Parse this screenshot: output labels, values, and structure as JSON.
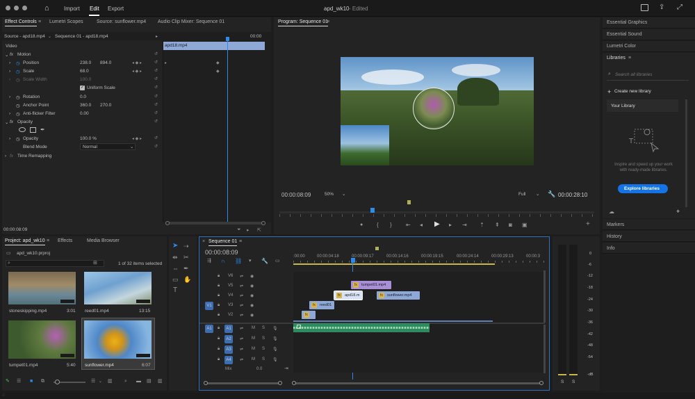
{
  "titlebar": {
    "menu_import": "Import",
    "menu_edit": "Edit",
    "menu_export": "Export",
    "doc_title": "apd_wk10",
    "doc_status": "- Edited"
  },
  "source_tabs": [
    "Effect Controls",
    "Lumetri Scopes",
    "Source: sunflower.mp4",
    "Audio Clip Mixer: Sequence 01"
  ],
  "effect_controls": {
    "source_label": "Source - apd18.mp4",
    "sequence_label": "Sequence 01 - apd18.mp4",
    "timeline_start": "00:00",
    "clip_name": "apd18.mp4",
    "section_video": "Video",
    "motion": "Motion",
    "position": "Position",
    "position_x": "238.0",
    "position_y": "894.0",
    "scale": "Scale",
    "scale_val": "68.0",
    "scale_width": "Scale Width",
    "scale_width_val": "100.0",
    "uniform_scale": "Uniform Scale",
    "rotation": "Rotation",
    "rotation_val": "0.0",
    "anchor": "Anchor Point",
    "anchor_x": "360.0",
    "anchor_y": "270.0",
    "antiflicker": "Anti-flicker Filter",
    "antiflicker_val": "0.00",
    "opacity_section": "Opacity",
    "opacity": "Opacity",
    "opacity_val": "100.0 %",
    "blend_mode": "Blend Mode",
    "blend_val": "Normal",
    "time_remap": "Time Remapping",
    "timecode": "00:00:08:09"
  },
  "program": {
    "title": "Program: Sequence 01",
    "timecode": "00:00:08:09",
    "zoom": "50%",
    "quality": "Full",
    "duration": "00:00:28:10"
  },
  "right_panel": {
    "essential_graphics": "Essential Graphics",
    "essential_sound": "Essential Sound",
    "lumetri_color": "Lumetri Color",
    "libraries": "Libraries",
    "search_placeholder": "Search all libraries",
    "create_library": "Create new library",
    "your_library": "Your Library",
    "inspire_text": "Inspire and speed up your work with ready-made libraries.",
    "explore_button": "Explore libraries",
    "markers": "Markers",
    "history": "History",
    "info": "Info"
  },
  "project": {
    "tab_project": "Project: apd_wk10",
    "tab_effects": "Effects",
    "tab_media": "Media Browser",
    "file_name": "apd_wk10.prproj",
    "items_selected": "1 of 32 items selected",
    "thumbs": [
      {
        "name": "stoneskipping.mp4",
        "dur": "3:01"
      },
      {
        "name": "reed01.mp4",
        "dur": "13:15"
      },
      {
        "name": "tumpet01.mp4",
        "dur": "5:40"
      },
      {
        "name": "sunflower.mp4",
        "dur": "6:07"
      }
    ]
  },
  "timeline": {
    "title": "Sequence 01",
    "timecode": "00:00:08:09",
    "ruler": [
      ":00:00",
      "00:00:04:18",
      "00:00:09:17",
      "00:00:14:16",
      "00:00:19:15",
      "00:00:24:14",
      "00:00:29:13",
      "00:00:3"
    ],
    "video_tracks": [
      "V6",
      "V5",
      "V4",
      "V3",
      "V2",
      "V1"
    ],
    "audio_tracks": [
      "A1",
      "A2",
      "A3",
      "A4"
    ],
    "mix_label": "Mix",
    "mix_val": "0.0",
    "src_v1": "V1",
    "src_a1": "A1",
    "m": "M",
    "s": "S",
    "clips": {
      "tumpet": "tumpet01.mp4",
      "apd": "apd18.m",
      "sunflower": "sunflower.mp4",
      "reed": "reed01"
    }
  },
  "meter": {
    "scale": [
      "0",
      "-6",
      "-12",
      "-18",
      "-24",
      "-30",
      "-36",
      "-42",
      "-48",
      "-54",
      "-dB"
    ],
    "s_left": "S",
    "s_right": "S"
  },
  "accent": "#2d8ceb"
}
